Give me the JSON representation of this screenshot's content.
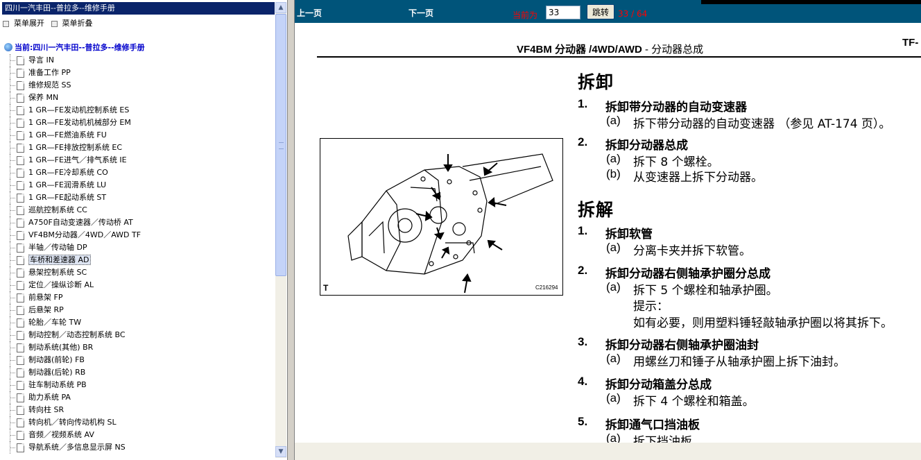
{
  "left_panel": {
    "title": "四川一汽丰田--普拉多--维修手册",
    "expand_label": "菜单展开",
    "collapse_label": "菜单折叠",
    "root_label": "当前:四川一汽丰田--普拉多--维修手册",
    "items": [
      {
        "label": "导言  IN"
      },
      {
        "label": "准备工作  PP"
      },
      {
        "label": "维修规范  SS"
      },
      {
        "label": "保养  MN"
      },
      {
        "label": "1 GR—FE发动机控制系统  ES"
      },
      {
        "label": "1 GR—FE发动机机械部分  EM"
      },
      {
        "label": "1 GR—FE燃油系统  FU"
      },
      {
        "label": "1 GR—FE排放控制系统  EC"
      },
      {
        "label": "1 GR—FE进气／排气系统  IE"
      },
      {
        "label": "1 GR—FE冷却系统  CO"
      },
      {
        "label": "1 GR—FE润滑系统  LU"
      },
      {
        "label": "1 GR—FE起动系统  ST"
      },
      {
        "label": "巡航控制系统  CC"
      },
      {
        "label": "A750F自动变速器／传动桥  AT"
      },
      {
        "label": "VF4BM分动器／4WD／AWD TF"
      },
      {
        "label": "半轴／传动轴  DP"
      },
      {
        "label": "车桥和差速器  AD",
        "selected": true
      },
      {
        "label": "悬架控制系统  SC"
      },
      {
        "label": "定位／操纵诊断  AL"
      },
      {
        "label": "前悬架  FP"
      },
      {
        "label": "后悬架  RP"
      },
      {
        "label": "轮胎／车轮  TW"
      },
      {
        "label": "制动控制／动态控制系统  BC"
      },
      {
        "label": "制动系统(其他) BR"
      },
      {
        "label": "制动器(前轮) FB"
      },
      {
        "label": "制动器(后轮) RB"
      },
      {
        "label": "驻车制动系统  PB"
      },
      {
        "label": "助力系统  PA"
      },
      {
        "label": "转向柱  SR"
      },
      {
        "label": "转向机／转向传动机构  SL"
      },
      {
        "label": "音频／视频系统  AV"
      },
      {
        "label": "导航系统／多信息显示屏  NS"
      }
    ]
  },
  "toolbar": {
    "prev_label": "上一页",
    "next_label": "下一页",
    "current_label": "当前为",
    "page_value": "33",
    "jump_label": "跳转",
    "page_count": "33 / 64"
  },
  "document": {
    "header_bold": "VF4BM 分动器 /4WD/AWD",
    "header_rest": " -  分动器总成",
    "header_code": "TF-",
    "figure": {
      "letter": "T",
      "code": "C216294"
    },
    "sections": [
      {
        "title": "拆卸"
      },
      {
        "title": "拆解"
      }
    ],
    "steps": [
      {
        "num": "1.",
        "title": "拆卸带分动器的自动变速器",
        "subs": [
          {
            "letter": "(a)",
            "text": "拆下带分动器的自动变速器 （参见 AT-174 页）。"
          }
        ]
      },
      {
        "num": "2.",
        "title": "拆卸分动器总成",
        "subs": [
          {
            "letter": "(a)",
            "text": "拆下 8 个螺栓。"
          },
          {
            "letter": "(b)",
            "text": "从变速器上拆下分动器。"
          }
        ]
      },
      {
        "num": "1.",
        "title": "拆卸软管",
        "subs": [
          {
            "letter": "(a)",
            "text": "分离卡夹并拆下软管。"
          }
        ]
      },
      {
        "num": "2.",
        "title": "拆卸分动器右侧轴承护圈分总成",
        "subs": [
          {
            "letter": "(a)",
            "text": "拆下 5 个螺栓和轴承护圈。"
          }
        ],
        "hint_label": "提示：",
        "hint_text": "如有必要，则用塑料锤轻敲轴承护圈以将其拆下。"
      },
      {
        "num": "3.",
        "title": "拆卸分动器右侧轴承护圈油封",
        "subs": [
          {
            "letter": "(a)",
            "text": "用螺丝刀和锤子从轴承护圈上拆下油封。"
          }
        ]
      },
      {
        "num": "4.",
        "title": "拆卸分动箱盖分总成",
        "subs": [
          {
            "letter": "(a)",
            "text": "拆下 4 个螺栓和箱盖。"
          }
        ]
      },
      {
        "num": "5.",
        "title": "拆卸通气口挡油板",
        "subs": [
          {
            "letter": "(a)",
            "text": "拆下挡油板"
          }
        ]
      }
    ]
  },
  "colors": {
    "toolbar_bg": "#00547a",
    "title_bar": "#0a246a",
    "root_link": "#0000cc",
    "page_red": "#ff0000"
  }
}
